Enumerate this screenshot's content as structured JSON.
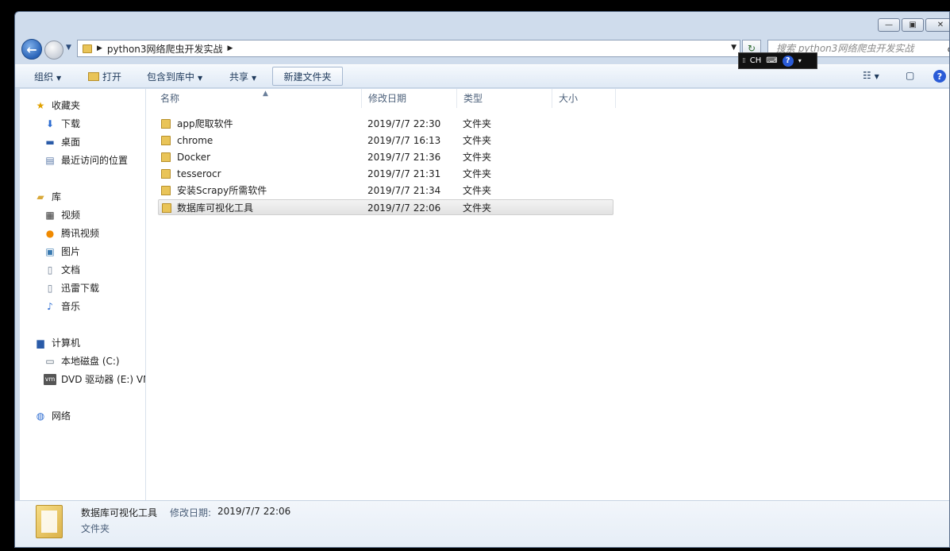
{
  "address": {
    "path_segment": "python3网络爬虫开发实战",
    "search_placeholder": "搜索 python3网络爬虫开发实战"
  },
  "ime": {
    "label": "CH"
  },
  "toolbar": {
    "organize": "组织",
    "open": "打开",
    "include_in_library": "包含到库中",
    "share": "共享",
    "new_folder": "新建文件夹"
  },
  "nav": {
    "favorites": "收藏夹",
    "downloads": "下载",
    "desktop": "桌面",
    "recent": "最近访问的位置",
    "libraries": "库",
    "videos": "视频",
    "tencent_video": "腾讯视频",
    "pictures": "图片",
    "documents": "文档",
    "thunder": "迅雷下载",
    "music": "音乐",
    "computer": "计算机",
    "local_disk": "本地磁盘 (C:)",
    "dvd": "DVD 驱动器 (E:) VM",
    "network": "网络"
  },
  "columns": {
    "name": "名称",
    "date": "修改日期",
    "type": "类型",
    "size": "大小"
  },
  "files": [
    {
      "name": "app爬取软件",
      "date": "2019/7/7 22:30",
      "type": "文件夹"
    },
    {
      "name": "chrome",
      "date": "2019/7/7 16:13",
      "type": "文件夹"
    },
    {
      "name": "Docker",
      "date": "2019/7/7 21:36",
      "type": "文件夹"
    },
    {
      "name": "tesserocr",
      "date": "2019/7/7 21:31",
      "type": "文件夹"
    },
    {
      "name": "安装Scrapy所需软件",
      "date": "2019/7/7 21:34",
      "type": "文件夹"
    },
    {
      "name": "数据库可视化工具",
      "date": "2019/7/7 22:06",
      "type": "文件夹"
    }
  ],
  "details": {
    "name": "数据库可视化工具",
    "date_label": "修改日期:",
    "date": "2019/7/7 22:06",
    "type": "文件夹"
  }
}
